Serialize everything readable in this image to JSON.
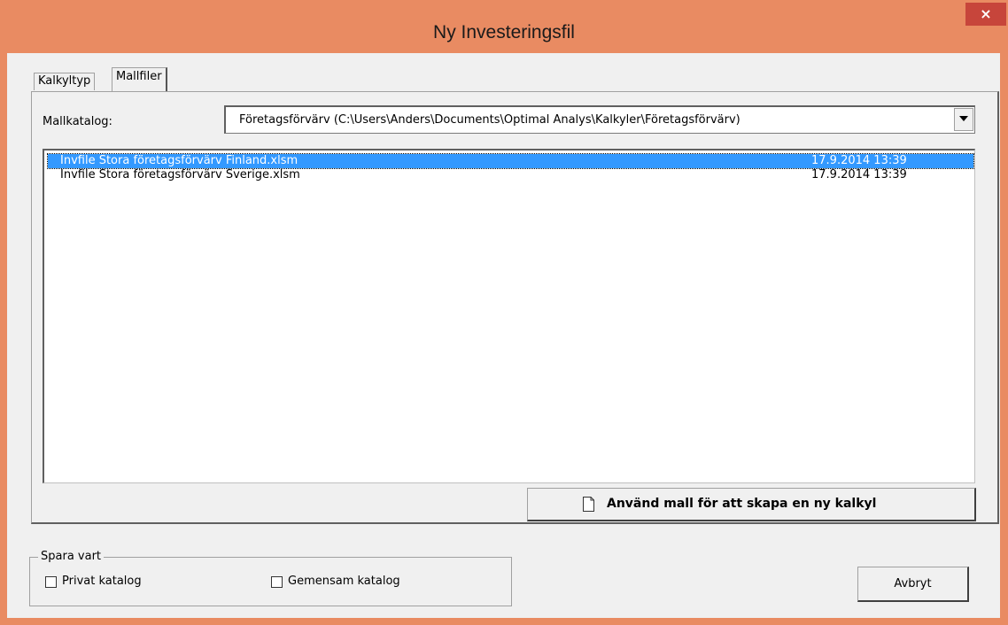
{
  "window": {
    "title": "Ny Investeringsfil",
    "close_glyph": "×"
  },
  "tabs": [
    {
      "label": "Kalkyltyp",
      "active": false
    },
    {
      "label": "Mallfiler",
      "active": true
    }
  ],
  "mallkatalog": {
    "label": "Mallkatalog:",
    "selected": "Företagsförvärv (C:\\Users\\Anders\\Documents\\Optimal Analys\\Kalkyler\\Företagsförvärv)",
    "dropdown_icon": "chevron-down-icon"
  },
  "files": [
    {
      "name": "Invfile Stora företagsförvärv Finland.xlsm",
      "date": "17.9.2014 13:39",
      "selected": true
    },
    {
      "name": "Invfile Stora företagsförvärv Sverige.xlsm",
      "date": "17.9.2014 13:39",
      "selected": false
    }
  ],
  "use_template_button": {
    "label": "Använd mall för att skapa en ny kalkyl",
    "icon": "document-icon"
  },
  "save_location": {
    "title": "Spara vart",
    "private_label": "Privat katalog",
    "private_checked": false,
    "shared_label": "Gemensam katalog",
    "shared_checked": false
  },
  "cancel_button": {
    "label": "Avbryt"
  },
  "colors": {
    "titlebar": "#e98b62",
    "close": "#c7453b",
    "selection": "#3399ff"
  }
}
